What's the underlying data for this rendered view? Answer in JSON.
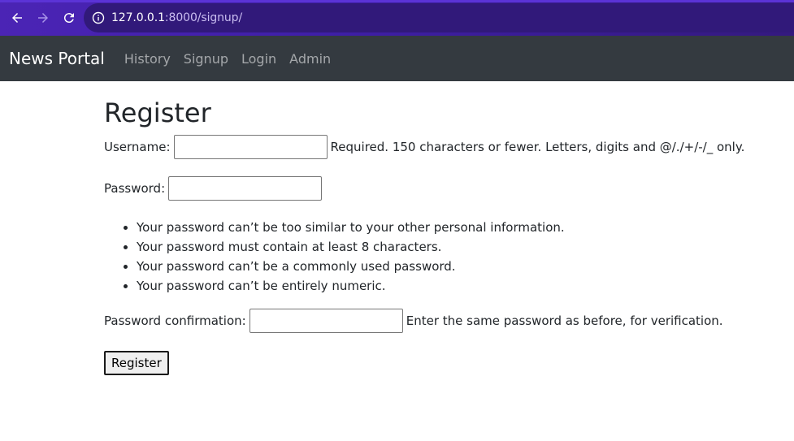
{
  "browser": {
    "url_host": "127.0.0.1",
    "url_rest": ":8000/signup/"
  },
  "navbar": {
    "brand": "News Portal",
    "links": [
      "History",
      "Signup",
      "Login",
      "Admin"
    ]
  },
  "form": {
    "title": "Register",
    "username_label": "Username:",
    "username_help": "Required. 150 characters or fewer. Letters, digits and @/./+/-/_ only.",
    "password_label": "Password:",
    "password_help": [
      "Your password can’t be too similar to your other personal information.",
      "Your password must contain at least 8 characters.",
      "Your password can’t be a commonly used password.",
      "Your password can’t be entirely numeric."
    ],
    "confirm_label": "Password confirmation:",
    "confirm_help": "Enter the same password as before, for verification.",
    "submit_label": "Register"
  }
}
